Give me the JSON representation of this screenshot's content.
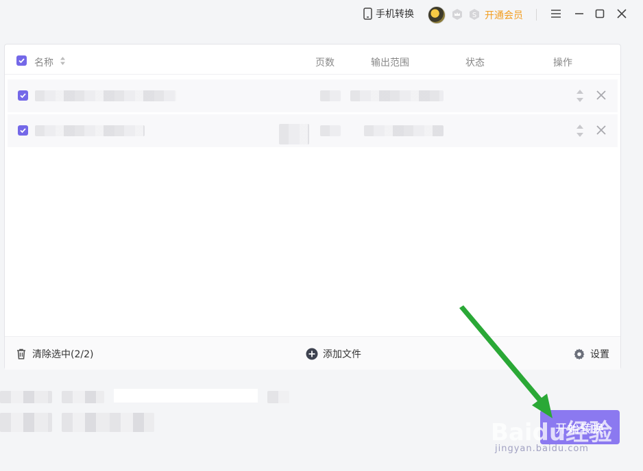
{
  "titlebar": {
    "phone_convert_label": "手机转换",
    "vip_label": "开通会员",
    "icons": [
      "phone-icon",
      "avatar",
      "crown-badge-icon",
      "coin-badge-icon",
      "menu-icon",
      "minimize-icon",
      "maximize-icon",
      "close-icon"
    ]
  },
  "table": {
    "columns": {
      "name": "名称",
      "pages": "页数",
      "range": "输出范围",
      "status": "状态",
      "action": "操作"
    },
    "rows": [
      {
        "checked": true
      },
      {
        "checked": true
      }
    ]
  },
  "footer": {
    "clear_label": "清除选中(2/2)",
    "add_label": "添加文件",
    "settings_label": "设置"
  },
  "start_button_label": "开始转换",
  "watermark": {
    "brand": "Baidu经验",
    "url": "jingyan.baidu.com"
  },
  "colors": {
    "accent": "#7468e8",
    "vip": "#f29d1f",
    "annotation_arrow": "#2aa836"
  }
}
